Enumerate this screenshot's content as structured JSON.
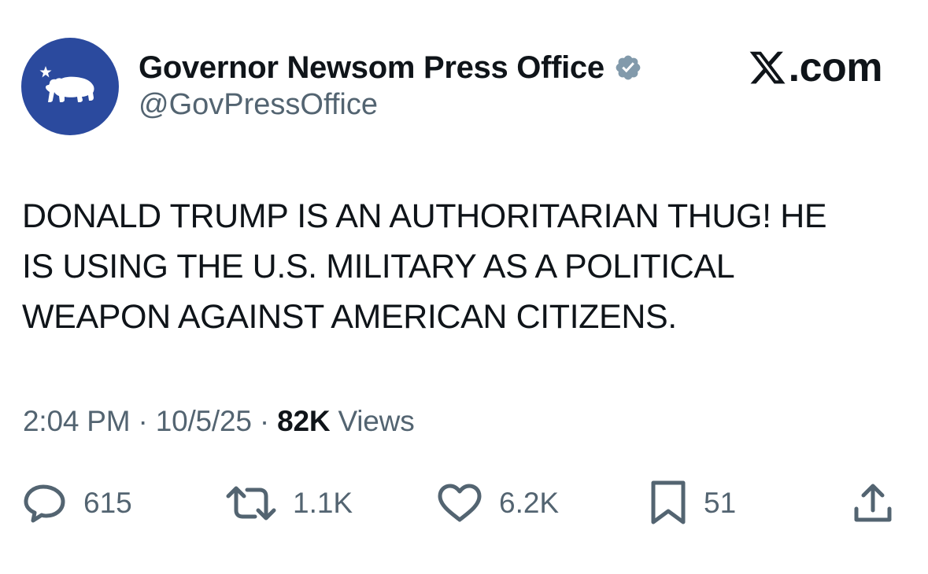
{
  "author": {
    "display_name": "Governor Newsom Press Office",
    "handle": "@GovPressOffice",
    "verified": true,
    "avatar_icon": "california-bear-star-icon",
    "avatar_color": "#2b4a9e"
  },
  "brand": {
    "label": ".com",
    "icon": "x-logo-icon"
  },
  "tweet": {
    "text": "DONALD TRUMP IS AN AUTHORITARIAN THUG! HE\nIS USING THE U.S. MILITARY AS A POLITICAL\nWEAPON AGAINST AMERICAN CITIZENS."
  },
  "meta": {
    "time": "2:04 PM",
    "separator": "·",
    "date": "10/5/25",
    "views_count": "82K",
    "views_label": "Views"
  },
  "actions": {
    "replies": "615",
    "reposts": "1.1K",
    "likes": "6.2K",
    "bookmarks": "51"
  },
  "colors": {
    "text_primary": "#0f1419",
    "text_secondary": "#536471",
    "verified_badge": "#829aab"
  }
}
